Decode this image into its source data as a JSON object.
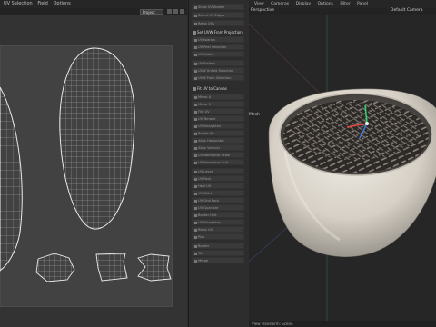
{
  "uv_editor": {
    "menu": [
      "UV Selection",
      "Field",
      "Options"
    ],
    "mode_value": "Project"
  },
  "panel": {
    "group1": [
      "Show UV Border",
      "Select UV Edges",
      "Relax UVs"
    ],
    "head1": "Set UVW From Projection",
    "group2": [
      "UV Islands",
      "UV Peel Selection",
      "UV Rotate"
    ],
    "group3": [
      "UV Flatten",
      "UVW Unfold Selection",
      "UVW From Selection"
    ],
    "head2": "Fit UV to Canvas",
    "group4": [
      "Mirror U",
      "Mirror V",
      "Flip UV",
      "UV Terrace",
      "UV Straighten",
      "Rotate 90",
      "Align Horizontal",
      "Align Vertical",
      "UV Normalize Scale",
      "UV Normalize Grid"
    ],
    "group5": [
      "UV Layer",
      "UV Pack",
      "Heal UV",
      "UV Stitch",
      "UV Grid Pack",
      "UV Quantize",
      "Border Unit",
      "UV Straighten",
      "Relax UV",
      "Pins"
    ],
    "group6": [
      "Border",
      "Tile",
      "Merge"
    ]
  },
  "viewport": {
    "menu": [
      "View",
      "Cameras",
      "Display",
      "Options",
      "Filter",
      "Panel"
    ],
    "label_perspective": "Perspective",
    "label_camera": "Default Camera",
    "label_mesh": "Mesh",
    "status": "View Transform: Scene"
  },
  "colors": {
    "uv_wire": "#e6e6e6",
    "bowl": "#dcd7cf",
    "seed_dark": "#2a2624",
    "seed_stripe": "#cfc8bd",
    "axis_green": "#2fd16b",
    "axis_red": "#e04848",
    "axis_blue": "#3a7ad8"
  }
}
